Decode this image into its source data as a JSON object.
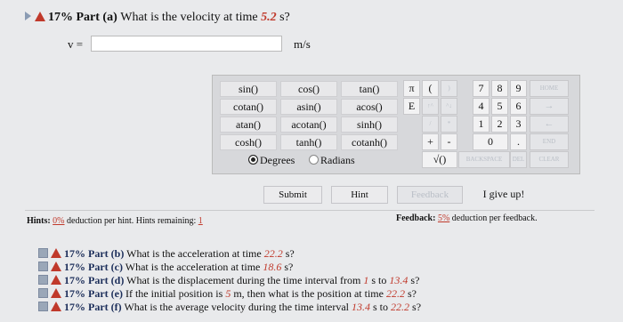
{
  "header": {
    "percent": "17%",
    "part": "Part (a)",
    "question": "What is the velocity at time",
    "time": "5.2",
    "suffix": "s?"
  },
  "answer": {
    "label": "v =",
    "value": "",
    "unit": "m/s"
  },
  "calc": {
    "functions": [
      [
        "sin()",
        "cos()",
        "tan()"
      ],
      [
        "cotan()",
        "asin()",
        "acos()"
      ],
      [
        "atan()",
        "acotan()",
        "sinh()"
      ],
      [
        "cosh()",
        "tanh()",
        "cotanh()"
      ]
    ],
    "degrees_label": "Degrees",
    "radians_label": "Radians",
    "angle_mode": "Degrees",
    "keys": {
      "pi": "π",
      "open_paren": "(",
      "close_paren": ")",
      "e": "E",
      "up": "↑^",
      "down": "^↓",
      "slash": "/",
      "star": "*",
      "plus": "+",
      "minus": "-",
      "sqrt": "√()",
      "d7": "7",
      "d8": "8",
      "d9": "9",
      "d4": "4",
      "d5": "5",
      "d6": "6",
      "d1": "1",
      "d2": "2",
      "d3": "3",
      "d0": "0",
      "dot": ".",
      "home": "HOME",
      "arrow_r": "→",
      "arrow_l": "←",
      "end": "END",
      "backspace": "BACKSPACE",
      "del": "DEL",
      "clear": "CLEAR"
    }
  },
  "actions": {
    "submit": "Submit",
    "hint": "Hint",
    "feedback": "Feedback",
    "giveup": "I give up!"
  },
  "hints": {
    "label": "Hints:",
    "pct": "0%",
    "text": "deduction per hint. Hints remaining:",
    "remaining": "1"
  },
  "feedback_info": {
    "label": "Feedback:",
    "pct": "5%",
    "text": "deduction per feedback."
  },
  "parts": [
    {
      "percent": "17%",
      "part": "Part (b)",
      "text": "What is the acceleration at time",
      "v1": "22.2",
      "after": "s?"
    },
    {
      "percent": "17%",
      "part": "Part (c)",
      "text": "What is the acceleration at time",
      "v1": "18.6",
      "after": "s?"
    },
    {
      "percent": "17%",
      "part": "Part (d)",
      "text": "What is the displacement during the time interval from",
      "v1": "1",
      "mid": "s to",
      "v2": "13.4",
      "after": "s?"
    },
    {
      "percent": "17%",
      "part": "Part (e)",
      "text": "If the initial position is",
      "v1": "5",
      "mid": "m, then what is the position at time",
      "v2": "22.2",
      "after": "s?"
    },
    {
      "percent": "17%",
      "part": "Part (f)",
      "text": "What is the average velocity during the time interval",
      "v1": "13.4",
      "mid": "s to",
      "v2": "22.2",
      "after": "s?"
    }
  ]
}
